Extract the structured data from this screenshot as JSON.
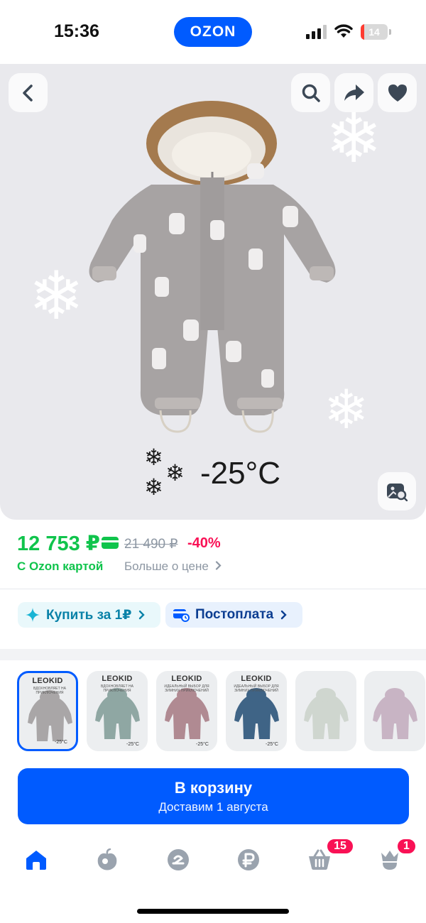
{
  "status_bar": {
    "time": "15:36",
    "battery": "14",
    "battery_level": 0.14
  },
  "brand": {
    "logo": "OZON"
  },
  "gallery": {
    "back_icon": "chevron-left-icon",
    "search_icon": "search-icon",
    "share_icon": "share-icon",
    "favorite_icon": "heart-icon",
    "visual_search_icon": "image-search-icon",
    "temperature": "-25°C"
  },
  "price": {
    "current": "12 753 ₽",
    "old": "21 490 ₽",
    "discount": "-40%",
    "ozon_card": "С Ozon картой",
    "more": "Больше о цене",
    "more_icon": "chevron-right-icon"
  },
  "chips": {
    "buy_for_one": "Купить за 1₽",
    "postpay": "Постоплата"
  },
  "thumbnails": [
    {
      "brand": "LEOKID",
      "caption": "ВДОХНОВЛЯЕТ НА ПРИКЛЮЧЕНИЯ",
      "temp": "-25°C",
      "color": "#a9a6a7",
      "selected": true
    },
    {
      "brand": "LEOKID",
      "caption": "ВДОХНОВЛЯЕТ НА ПРИКЛЮЧЕНИЯ",
      "temp": "-25°C",
      "color": "#8fa7a3",
      "selected": false
    },
    {
      "brand": "LEOKID",
      "caption": "ИДЕАЛЬНЫЙ ВЫБОР ДЛЯ ЗИМНИХ ПРИКЛЮЧЕНИЙ",
      "temp": "-25°C",
      "color": "#b08a92",
      "selected": false
    },
    {
      "brand": "LEOKID",
      "caption": "ИДЕАЛЬНЫЙ ВЫБОР ДЛЯ ЗИМНИХ ПРИКЛЮЧЕНИЙ",
      "temp": "-25°C",
      "color": "#3f6486",
      "selected": false
    },
    {
      "brand": "",
      "caption": "",
      "temp": "",
      "color": "#cfd6cf",
      "selected": false
    },
    {
      "brand": "",
      "caption": "",
      "temp": "",
      "color": "#c8b4c4",
      "selected": false
    }
  ],
  "cart": {
    "label": "В корзину",
    "delivery": "Доставим 1 августа"
  },
  "tabbar": {
    "items": [
      {
        "name": "home-icon",
        "active": true
      },
      {
        "name": "fresh-icon",
        "active": false
      },
      {
        "name": "ozon-icon",
        "active": false
      },
      {
        "name": "ruble-icon",
        "active": false
      },
      {
        "name": "cart-icon",
        "active": false
      },
      {
        "name": "profile-icon",
        "active": false
      }
    ],
    "cart_badge": "15",
    "profile_badge": "1"
  },
  "colors": {
    "accent": "#005bff",
    "price_green": "#10c44c",
    "discount_pink": "#f91155",
    "muted": "#8d97a3"
  }
}
